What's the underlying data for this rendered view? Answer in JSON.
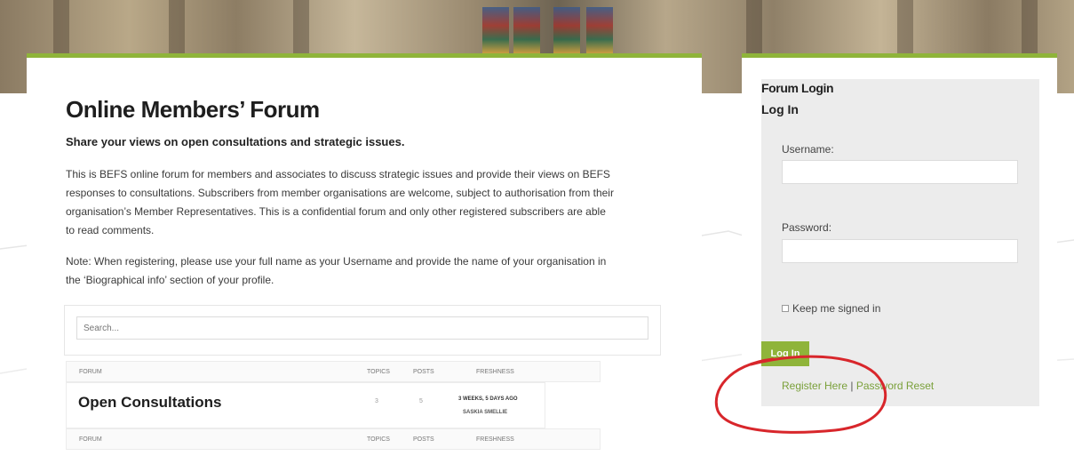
{
  "main": {
    "title": "Online Members’ Forum",
    "subtitle": "Share your views on open consultations and strategic issues.",
    "intro": "This is BEFS online forum for members and associates to discuss strategic issues and provide their views on BEFS responses to consultations. Subscribers from member organisations are welcome, subject to authorisation from their organisation’s Member Representatives. This is a confidential forum and only other registered subscribers are able to read comments.",
    "note": "Note: When registering, please use your full name as your Username and provide the name of your organisation in the ‘Biographical info’ section of your profile.",
    "search_placeholder": "Search...",
    "table": {
      "columns": [
        "FORUM",
        "TOPICS",
        "POSTS",
        "FRESHNESS"
      ],
      "rows": [
        {
          "forum": "Open Consultations",
          "topics": "3",
          "posts": "5",
          "freshness": "3 WEEKS, 5 DAYS AGO",
          "user": "SASKIA SMELLIE"
        }
      ]
    }
  },
  "sidebar": {
    "heading": "Forum Login",
    "subheading": "Log In",
    "username_label": "Username:",
    "password_label": "Password:",
    "remember_label": "Keep me signed in",
    "login_button": "Log In",
    "register_link": "Register Here",
    "separator": "|",
    "reset_link": "Password Reset"
  },
  "colors": {
    "accent_green": "#8fb43a",
    "annotation_red": "#d8262b"
  }
}
